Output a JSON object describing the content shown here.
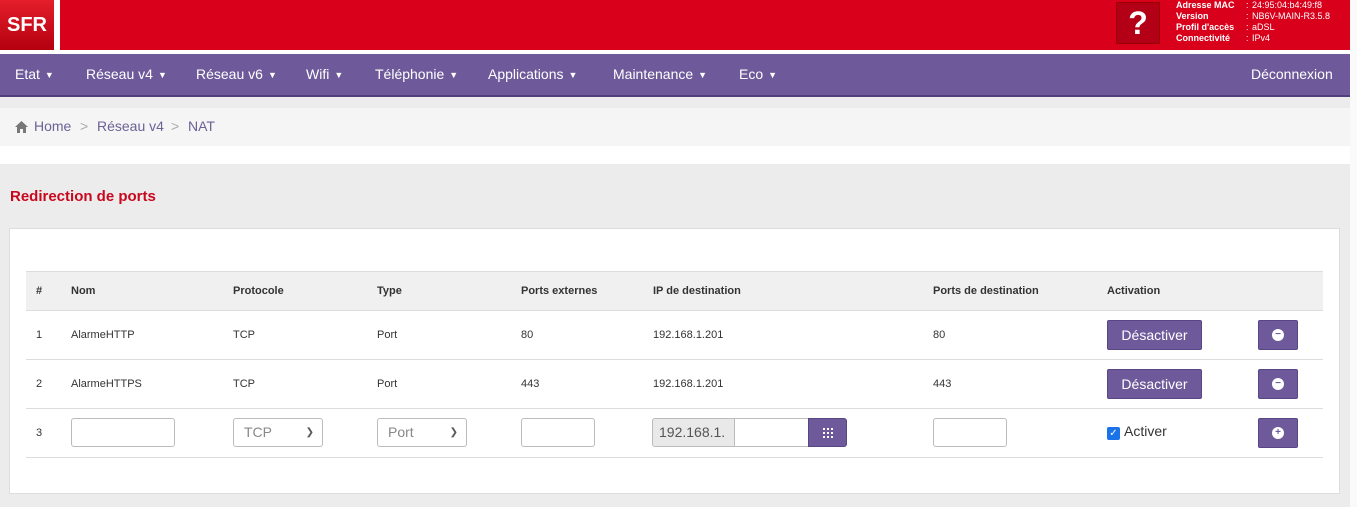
{
  "header": {
    "logo": "SFR",
    "help": "?",
    "info": [
      {
        "key": "Adresse MAC",
        "value": "24:95:04:b4:49:f8"
      },
      {
        "key": "Version",
        "value": "NB6V-MAIN-R3.5.8"
      },
      {
        "key": "Profil d'accès",
        "value": "aDSL"
      },
      {
        "key": "Connectivité",
        "value": "IPv4"
      }
    ]
  },
  "nav": {
    "items": [
      "Etat",
      "Réseau v4",
      "Réseau v6",
      "Wifi",
      "Téléphonie",
      "Applications",
      "Maintenance",
      "Eco"
    ],
    "logout": "Déconnexion"
  },
  "breadcrumb": {
    "home": "Home",
    "level1": "Réseau v4",
    "level2": "NAT",
    "separator": ">"
  },
  "section": {
    "title": "Redirection de ports"
  },
  "table": {
    "headers": [
      "#",
      "Nom",
      "Protocole",
      "Type",
      "Ports externes",
      "IP de destination",
      "Ports de destination",
      "Activation"
    ],
    "rows": [
      {
        "num": "1",
        "nom": "AlarmeHTTP",
        "protocole": "TCP",
        "type": "Port",
        "ports_ext": "80",
        "ip": "192.168.1.201",
        "ports_dest": "80",
        "action": "Désactiver"
      },
      {
        "num": "2",
        "nom": "AlarmeHTTPS",
        "protocole": "TCP",
        "type": "Port",
        "ports_ext": "443",
        "ip": "192.168.1.201",
        "ports_dest": "443",
        "action": "Désactiver"
      }
    ],
    "new_row": {
      "num": "3",
      "protocole": "TCP",
      "type": "Port",
      "ip_prefix": "192.168.1.",
      "activate_label": "Activer",
      "activate_checked": true
    }
  },
  "colors": {
    "brand_red": "#d8001a",
    "nav_purple": "#6e5a9a",
    "title_red": "#c8081e"
  }
}
